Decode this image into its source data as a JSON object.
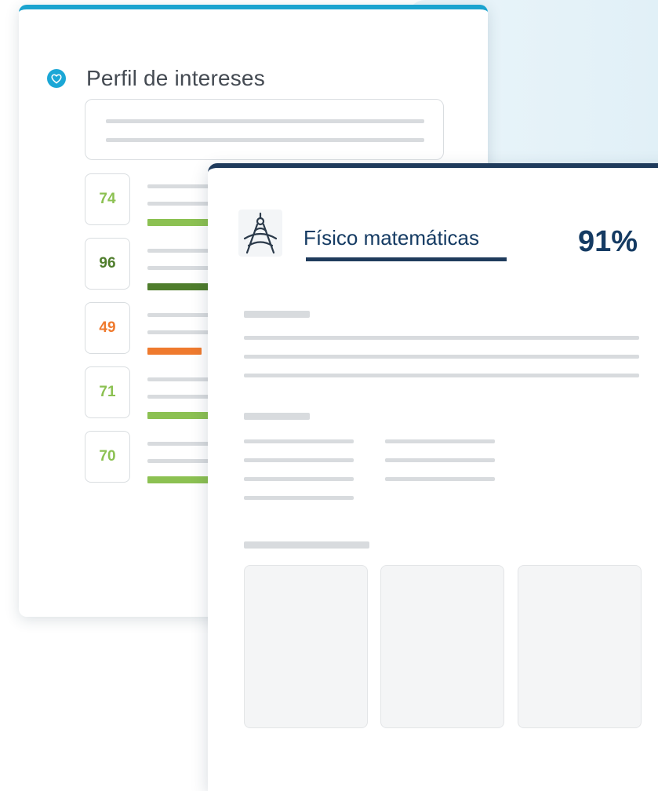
{
  "profile": {
    "title": "Perfil de intereses",
    "icon": "heart-icon",
    "accent_color": "#1ba7d6",
    "scores": [
      {
        "value": "74",
        "color": "#8cc152",
        "fill": 0.74
      },
      {
        "value": "96",
        "color": "#4f7d2c",
        "fill": 0.96
      },
      {
        "value": "49",
        "color": "#ef7a2e",
        "fill": 0.49
      },
      {
        "value": "71",
        "color": "#8cc152",
        "fill": 0.71
      },
      {
        "value": "70",
        "color": "#8cc152",
        "fill": 0.7
      }
    ]
  },
  "career": {
    "title": "Físico matemáticas",
    "percent": "91%",
    "icon": "drafting-compass-icon",
    "color": "#153b63"
  }
}
